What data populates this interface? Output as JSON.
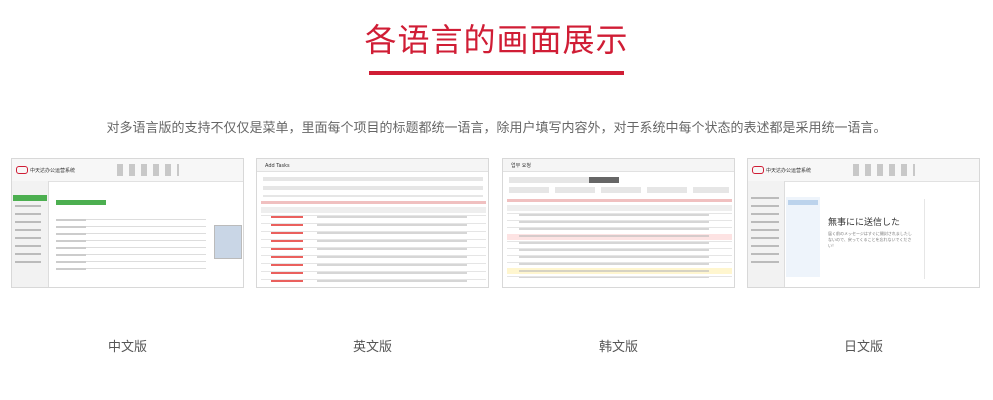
{
  "heading": "各语言的画面展示",
  "description": "对多语言版的支持不仅仅是菜单，里面每个项目的标题都统一语言，除用户填写内容外，对于系统中每个状态的表述都是采用统一语言。",
  "versions": [
    {
      "label": "中文版",
      "app_title": "中天达办公运营系统"
    },
    {
      "label": "英文版",
      "app_title": "Add Tasks"
    },
    {
      "label": "韩文版",
      "app_title": "업무 요청"
    },
    {
      "label": "日文版",
      "app_title": "中天达办公运营系统",
      "notice_title": "無事にに送信した",
      "notice_body_1": "届く前のメッセージはすぐに開封されましたし",
      "notice_body_2": "ないので、戻ってくることを忘れないでくださ",
      "notice_body_3": "い！"
    }
  ],
  "colors": {
    "accent": "#d01d35",
    "green": "#4caf50",
    "red_text": "#e53935"
  }
}
